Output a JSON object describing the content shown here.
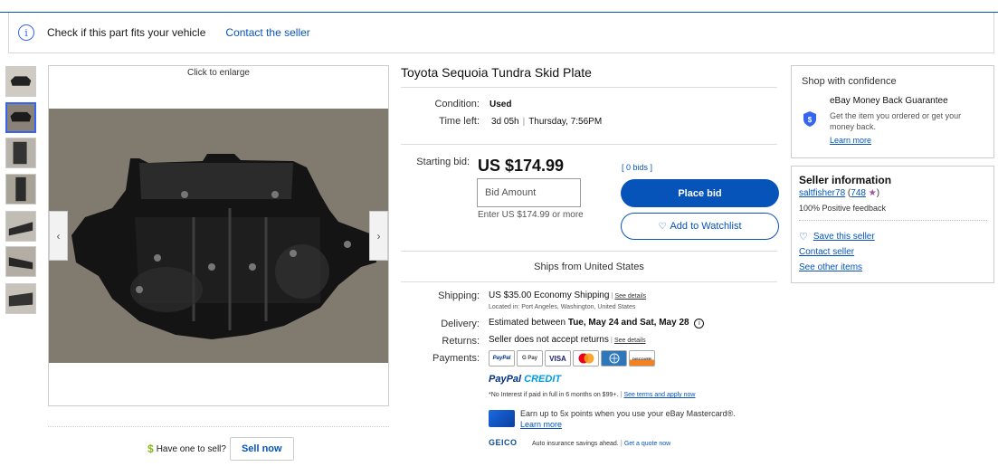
{
  "banner": {
    "check_fit": "Check if this part fits your vehicle",
    "contact_seller": "Contact the seller"
  },
  "gallery": {
    "click_to_enlarge": "Click to enlarge",
    "thumbnail_count": 7,
    "selected_index": 1
  },
  "sell": {
    "dollar_icon": "$",
    "have_one": "Have one to sell?",
    "sell_now": "Sell now"
  },
  "item": {
    "title": "Toyota Sequoia Tundra Skid Plate",
    "condition_label": "Condition:",
    "condition_value": "Used",
    "time_left_label": "Time left:",
    "time_left_value": "3d 05h",
    "time_left_end": "Thursday, 7:56PM"
  },
  "bid": {
    "starting_bid_label": "Starting bid:",
    "price": "US $174.99",
    "bids_count": "[ 0 bids ]",
    "input_placeholder": "Bid Amount",
    "hint": "Enter US $174.99 or more",
    "place_bid": "Place bid",
    "watchlist": "Add to Watchlist"
  },
  "shipping": {
    "ships_from": "Ships from United States",
    "shipping_label": "Shipping:",
    "shipping_value": "US $35.00 Economy Shipping",
    "see_details": "See details",
    "located_in": "Located in: Port Angeles, Washington, United States",
    "delivery_label": "Delivery:",
    "delivery_prefix": "Estimated between ",
    "delivery_range": "Tue, May 24 and Sat, May 28",
    "returns_label": "Returns:",
    "returns_value": "Seller does not accept returns",
    "returns_details": "See details",
    "payments_label": "Payments:"
  },
  "payments": {
    "icons": [
      "PayPal",
      "G Pay",
      "VISA",
      "",
      "",
      "DISCOVER"
    ],
    "paypal_credit_1": "PayPal",
    "paypal_credit_2": "CREDIT",
    "credit_note": "*No Interest if paid in full in 6 months on $99+.",
    "credit_terms": "See terms and apply now",
    "mastercard_line1": "Earn up to 5x points when you use your eBay Mastercard®.",
    "mastercard_learn": "Learn more",
    "geico_logo": "GEICO",
    "geico_text": "Auto insurance savings ahead.",
    "geico_quote": "Get a quote now"
  },
  "confidence": {
    "title": "Shop with confidence",
    "mbg_title": "eBay Money Back Guarantee",
    "mbg_desc": "Get the item you ordered or get your money back.",
    "learn_more": "Learn more"
  },
  "seller": {
    "title": "Seller information",
    "name": "saltfisher78",
    "score": "748",
    "feedback": "100% Positive feedback",
    "save": "Save this seller",
    "contact": "Contact seller",
    "see_items": "See other items"
  },
  "colors": {
    "accent": "#0654ba",
    "link": "#3665f3",
    "star": "#a54f9e"
  }
}
